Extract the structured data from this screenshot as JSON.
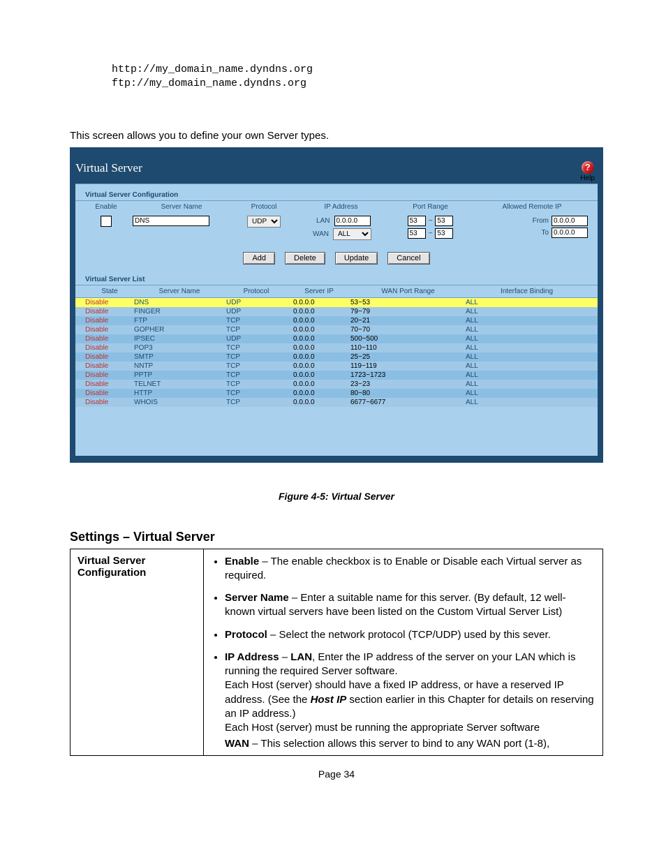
{
  "urls": {
    "http": "http://my_domain_name.dyndns.org",
    "ftp": "ftp://my_domain_name.dyndns.org"
  },
  "intro": "This screen allows you to define your own Server types.",
  "app": {
    "title": "Virtual Server",
    "help_label": "Help",
    "config_section": "Virtual Server Configuration",
    "list_section": "Virtual Server List",
    "headers": {
      "enable": "Enable",
      "server_name": "Server Name",
      "protocol": "Protocol",
      "ip_address": "IP Address",
      "port_range": "Port Range",
      "allowed_remote_ip": "Allowed Remote IP",
      "state": "State",
      "server_ip": "Server IP",
      "wan_port_range": "WAN Port Range",
      "interface_binding": "Interface Binding"
    },
    "form": {
      "server_name_value": "DNS",
      "protocol_value": "UDP",
      "lan_label": "LAN",
      "wan_label": "WAN",
      "lan_ip": "0.0.0.0",
      "wan_value": "ALL",
      "port_from1": "53",
      "port_to1": "53",
      "port_from2": "53",
      "port_to2": "53",
      "tilde": "~",
      "from_label": "From",
      "to_label": "To",
      "from_ip": "0.0.0.0",
      "to_ip": "0.0.0.0"
    },
    "buttons": {
      "add": "Add",
      "delete": "Delete",
      "update": "Update",
      "cancel": "Cancel"
    },
    "list": [
      {
        "state": "Disable",
        "name": "DNS",
        "proto": "UDP",
        "ip": "0.0.0.0",
        "range": "53~53",
        "bind": "ALL",
        "selected": true
      },
      {
        "state": "Disable",
        "name": "FINGER",
        "proto": "UDP",
        "ip": "0.0.0.0",
        "range": "79~79",
        "bind": "ALL"
      },
      {
        "state": "Disable",
        "name": "FTP",
        "proto": "TCP",
        "ip": "0.0.0.0",
        "range": "20~21",
        "bind": "ALL"
      },
      {
        "state": "Disable",
        "name": "GOPHER",
        "proto": "TCP",
        "ip": "0.0.0.0",
        "range": "70~70",
        "bind": "ALL"
      },
      {
        "state": "Disable",
        "name": "IPSEC",
        "proto": "UDP",
        "ip": "0.0.0.0",
        "range": "500~500",
        "bind": "ALL"
      },
      {
        "state": "Disable",
        "name": "POP3",
        "proto": "TCP",
        "ip": "0.0.0.0",
        "range": "110~110",
        "bind": "ALL"
      },
      {
        "state": "Disable",
        "name": "SMTP",
        "proto": "TCP",
        "ip": "0.0.0.0",
        "range": "25~25",
        "bind": "ALL"
      },
      {
        "state": "Disable",
        "name": "NNTP",
        "proto": "TCP",
        "ip": "0.0.0.0",
        "range": "119~119",
        "bind": "ALL"
      },
      {
        "state": "Disable",
        "name": "PPTP",
        "proto": "TCP",
        "ip": "0.0.0.0",
        "range": "1723~1723",
        "bind": "ALL"
      },
      {
        "state": "Disable",
        "name": "TELNET",
        "proto": "TCP",
        "ip": "0.0.0.0",
        "range": "23~23",
        "bind": "ALL"
      },
      {
        "state": "Disable",
        "name": "HTTP",
        "proto": "TCP",
        "ip": "0.0.0.0",
        "range": "80~80",
        "bind": "ALL"
      },
      {
        "state": "Disable",
        "name": "WHOIS",
        "proto": "TCP",
        "ip": "0.0.0.0",
        "range": "6677~6677",
        "bind": "ALL"
      }
    ]
  },
  "caption": "Figure 4-5: Virtual Server",
  "settings_heading": "Settings – Virtual Server",
  "desc": {
    "left": "Virtual Server Configuration",
    "enable_b": "Enable",
    "enable_t": " – The enable checkbox is to Enable or Disable each Virtual server as required.",
    "servername_b": "Server Name",
    "servername_t": " – Enter a suitable name for this server. (By default, 12 well-known virtual servers have been listed on the Custom Virtual Server List)",
    "protocol_b": "Protocol",
    "protocol_t": "  – Select the network protocol (TCP/UDP) used by this sever.",
    "ip_b1": "IP Address",
    "ip_b2": "LAN",
    "ip_t1": ", Enter the IP address of the server on your LAN which is running the required Server software.",
    "ip_t2": "Each Host (server) should have a fixed IP address, or have a reserved IP address. (See the ",
    "ip_b3": "Host IP",
    "ip_t3": " section earlier in this Chapter for details on reserving an IP address.)",
    "ip_t4": "Each Host (server) must be running the appropriate Server software",
    "wan_b": "WAN",
    "wan_t": " – This selection allows this server to bind to any WAN port (1-8),",
    "dash": " – "
  },
  "page_number": "Page 34"
}
